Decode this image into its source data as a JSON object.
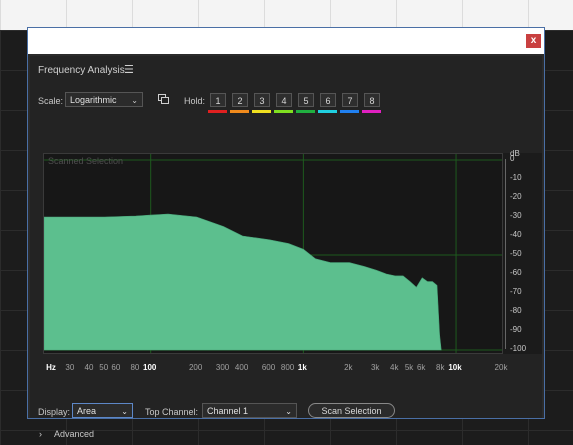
{
  "dialog": {
    "close_label": "x"
  },
  "panel": {
    "title": "Frequency Analysis",
    "menu_icon": "hamburger-menu-icon"
  },
  "scale": {
    "label": "Scale:",
    "value": "Logarithmic"
  },
  "hold": {
    "label": "Hold:",
    "buttons": [
      "1",
      "2",
      "3",
      "4",
      "5",
      "6",
      "7",
      "8"
    ],
    "colors": [
      "#e02020",
      "#f08a1c",
      "#f0e020",
      "#80e020",
      "#20b040",
      "#20d0e0",
      "#2080f0",
      "#e020c0"
    ]
  },
  "graph": {
    "overlay_label": "Scanned Selection",
    "fill_color": "#5cbf8e",
    "grid_color": "#1e5a1e",
    "db_unit": "dB",
    "db_ticks": [
      "0",
      "-10",
      "-20",
      "-30",
      "-40",
      "-50",
      "-60",
      "-70",
      "-80",
      "-90",
      "-100"
    ],
    "hz_ticks": [
      "Hz",
      "30",
      "40",
      "50",
      "60",
      "80",
      "100",
      "200",
      "300",
      "400",
      "600",
      "800",
      "1k",
      "2k",
      "3k",
      "4k",
      "5k",
      "6k",
      "8k",
      "10k",
      "20k"
    ],
    "hz_major": [
      "100",
      "1k",
      "10k"
    ]
  },
  "chart_data": {
    "type": "area",
    "xscale": "log",
    "xlim": [
      20,
      20000
    ],
    "ylim": [
      -100,
      0
    ],
    "x": [
      20,
      30,
      50,
      80,
      100,
      130,
      150,
      200,
      300,
      400,
      600,
      800,
      1000,
      1200,
      1500,
      2000,
      2500,
      3000,
      3500,
      4000,
      4500,
      5000,
      5500,
      6000,
      6500,
      7000,
      7500,
      7800,
      8000
    ],
    "y": [
      -30,
      -30,
      -30,
      -29.5,
      -29,
      -28.5,
      -29,
      -30,
      -35,
      -40,
      -42,
      -44,
      -47,
      -52,
      -54,
      -54,
      -56,
      -58,
      -60,
      -61,
      -61,
      -64,
      -67,
      -62,
      -64,
      -64,
      -66,
      -92,
      -100
    ]
  },
  "footer": {
    "display_label": "Display:",
    "display_value": "Area",
    "top_channel_label": "Top Channel:",
    "top_channel_value": "Channel 1",
    "scan_button": "Scan Selection",
    "advanced_label": "Advanced"
  }
}
